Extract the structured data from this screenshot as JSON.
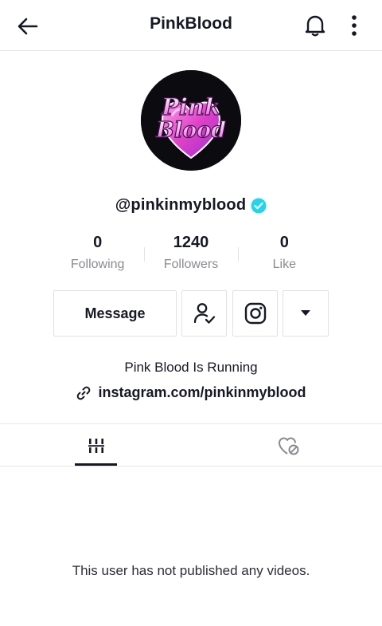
{
  "header": {
    "title": "PinkBlood",
    "back_icon": "arrow-left-icon",
    "bell_icon": "bell-icon",
    "more_icon": "more-vertical-icon"
  },
  "profile": {
    "avatar_logo_text": [
      "Pink",
      "Blood"
    ],
    "handle": "@pinkinmyblood",
    "verified": true,
    "verified_color": "#20d5ec",
    "brand_pink": "#e040c8"
  },
  "stats": [
    {
      "value": "0",
      "label": "Following"
    },
    {
      "value": "1240",
      "label": "Followers"
    },
    {
      "value": "0",
      "label": "Like"
    }
  ],
  "actions": {
    "message_label": "Message",
    "follow_icon": "user-check-icon",
    "instagram_icon": "instagram-icon",
    "more_icon": "caret-down-icon"
  },
  "bio": {
    "text": "Pink Blood Is Running",
    "link_icon": "link-icon",
    "link": "instagram.com/pinkinmyblood"
  },
  "tabs": [
    {
      "name": "videos",
      "icon": "grid-icon",
      "active": true
    },
    {
      "name": "liked",
      "icon": "liked-hidden-icon",
      "active": false
    }
  ],
  "empty_state": "This user has not published any videos."
}
